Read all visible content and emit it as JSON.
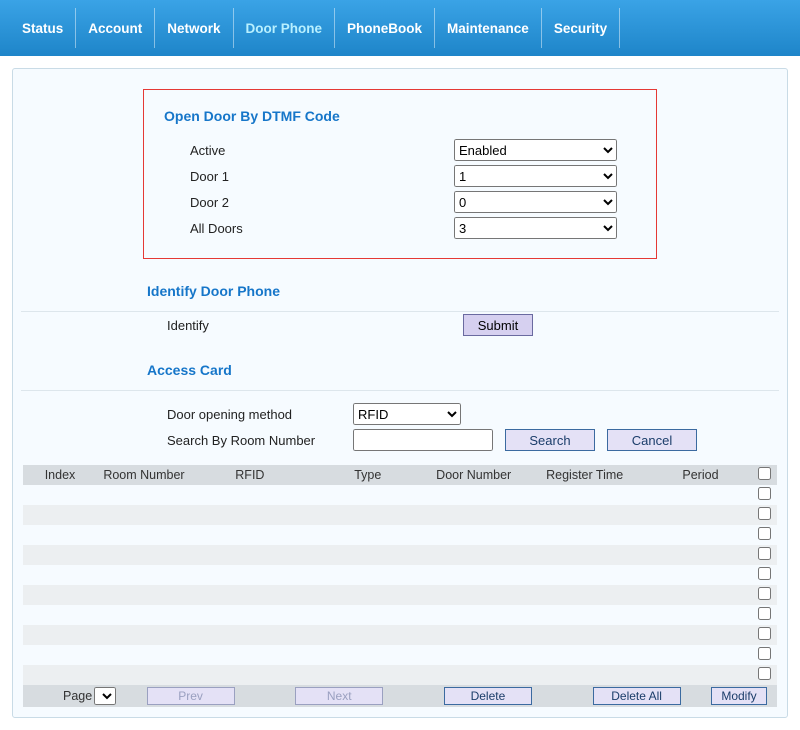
{
  "nav": {
    "items": [
      {
        "label": "Status",
        "active": false
      },
      {
        "label": "Account",
        "active": false
      },
      {
        "label": "Network",
        "active": false
      },
      {
        "label": "Door Phone",
        "active": true
      },
      {
        "label": "PhoneBook",
        "active": false
      },
      {
        "label": "Maintenance",
        "active": false
      },
      {
        "label": "Security",
        "active": false
      }
    ]
  },
  "sections": {
    "dtmf": {
      "title": "Open Door By DTMF Code",
      "active_label": "Active",
      "active_value": "Enabled",
      "door1_label": "Door 1",
      "door1_value": "1",
      "door2_label": "Door 2",
      "door2_value": "0",
      "alldoors_label": "All Doors",
      "alldoors_value": "3"
    },
    "identify": {
      "title": "Identify Door Phone",
      "label": "Identify",
      "button": "Submit"
    },
    "access": {
      "title": "Access Card",
      "method_label": "Door opening method",
      "method_value": "RFID",
      "search_label": "Search By Room Number",
      "search_value": "",
      "search_btn": "Search",
      "cancel_btn": "Cancel"
    }
  },
  "table": {
    "headers": {
      "index": "Index",
      "room": "Room Number",
      "rfid": "RFID",
      "type": "Type",
      "door": "Door Number",
      "register": "Register Time",
      "period": "Period"
    },
    "rows": [
      {},
      {},
      {},
      {},
      {},
      {},
      {},
      {},
      {},
      {}
    ]
  },
  "footer": {
    "page_label": "Page",
    "page_value": "",
    "prev": "Prev",
    "next": "Next",
    "delete": "Delete",
    "delete_all": "Delete All",
    "modify": "Modify"
  }
}
